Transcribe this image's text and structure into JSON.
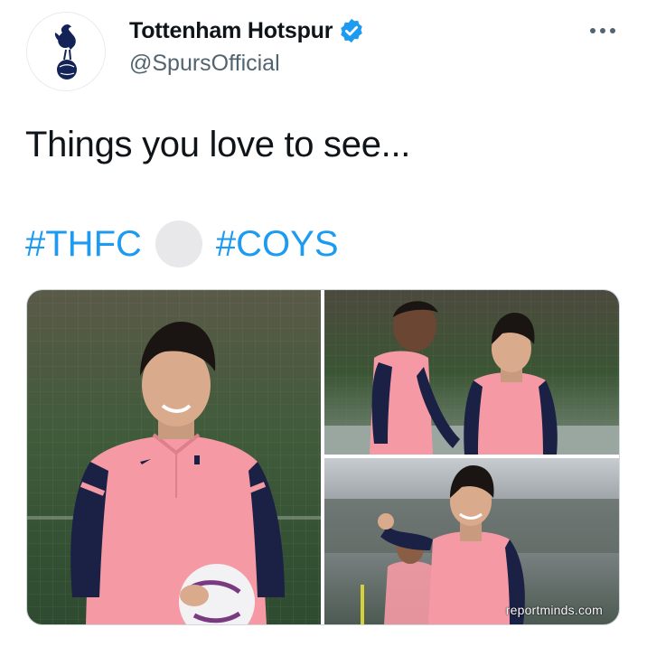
{
  "tweet": {
    "author": {
      "display_name": "Tottenham Hotspur",
      "handle": "@SpursOfficial",
      "verified": true,
      "avatar_icon": "cockerel-crest-icon",
      "crest_color": "#132257"
    },
    "more_icon": "ellipsis-icon",
    "text": "Things you love to see...",
    "hashtags": [
      "#THFC",
      "#COYS"
    ],
    "hashtag_color": "#1d9bf0",
    "media": {
      "photos": [
        {
          "description_icon": "player-smiling-with-ball-photo"
        },
        {
          "description_icon": "two-players-training-photo"
        },
        {
          "description_icon": "player-celebrating-photo"
        }
      ],
      "watermark": "reportminds.com"
    }
  },
  "colors": {
    "verified_badge": "#1d9bf0",
    "kit_pink": "#f59aa5",
    "kit_navy": "#1a2145"
  }
}
